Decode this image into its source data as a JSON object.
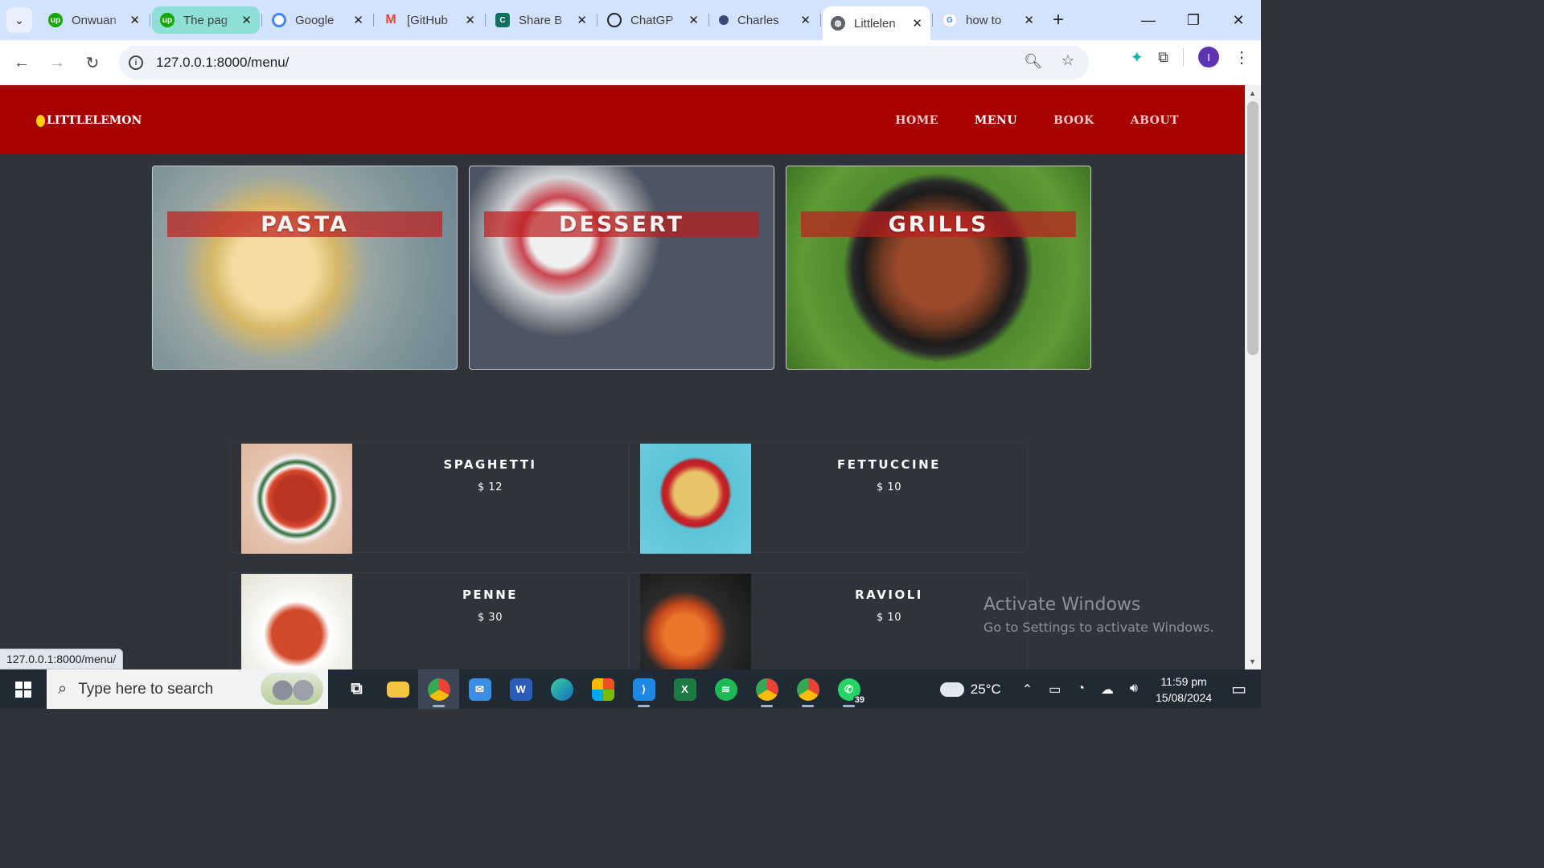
{
  "browser": {
    "tabs": [
      {
        "title": "Onwuan",
        "favicon": "upwork-icon",
        "color": "#14a800",
        "state": "normal"
      },
      {
        "title": "The pag",
        "favicon": "upwork-icon",
        "color": "#14a800",
        "state": "highlight"
      },
      {
        "title": "Google",
        "favicon": "google-lens-icon",
        "color": "#4285f4",
        "state": "normal"
      },
      {
        "title": "[GitHub",
        "favicon": "gmail-icon",
        "color": "#ea4335",
        "state": "normal"
      },
      {
        "title": "Share B",
        "favicon": "coursera-c-icon",
        "color": "#0f6e5c",
        "state": "normal"
      },
      {
        "title": "ChatGP",
        "favicon": "openai-icon",
        "color": "#202123",
        "state": "normal"
      },
      {
        "title": "Charles",
        "favicon": "github-icon",
        "color": "#24292f",
        "state": "normal"
      },
      {
        "title": "Littlelen",
        "favicon": "globe-icon",
        "color": "#5f6368",
        "state": "active"
      },
      {
        "title": "how to",
        "favicon": "google-g-icon",
        "color": "#4285f4",
        "state": "normal"
      }
    ],
    "url": "127.0.0.1:8000/menu/",
    "avatar_initial": "I",
    "status_url": "127.0.0.1:8000/menu/"
  },
  "site": {
    "logo": "LITTLELEMON",
    "nav": [
      {
        "label": "HOME",
        "current": false
      },
      {
        "label": "MENU",
        "current": true
      },
      {
        "label": "BOOK",
        "current": false
      },
      {
        "label": "ABOUT",
        "current": false
      }
    ],
    "categories": [
      "PASTA",
      "DESSERT",
      "GRILLS"
    ],
    "items": [
      {
        "name": "SPAGHETTI",
        "price": "$ 12"
      },
      {
        "name": "FETTUCCINE",
        "price": "$ 10"
      },
      {
        "name": "PENNE",
        "price": "$ 30"
      },
      {
        "name": "RAVIOLI",
        "price": "$ 10"
      }
    ],
    "colors": {
      "header": "#a80000",
      "body": "#2f333a",
      "lemon": "#ffd400"
    }
  },
  "watermark": {
    "line1": "Activate Windows",
    "line2": "Go to Settings to activate Windows."
  },
  "taskbar": {
    "search_placeholder": "Type here to search",
    "whatsapp_badge": "39",
    "weather": "25°C",
    "time": "11:59 pm",
    "date": "15/08/2024"
  }
}
